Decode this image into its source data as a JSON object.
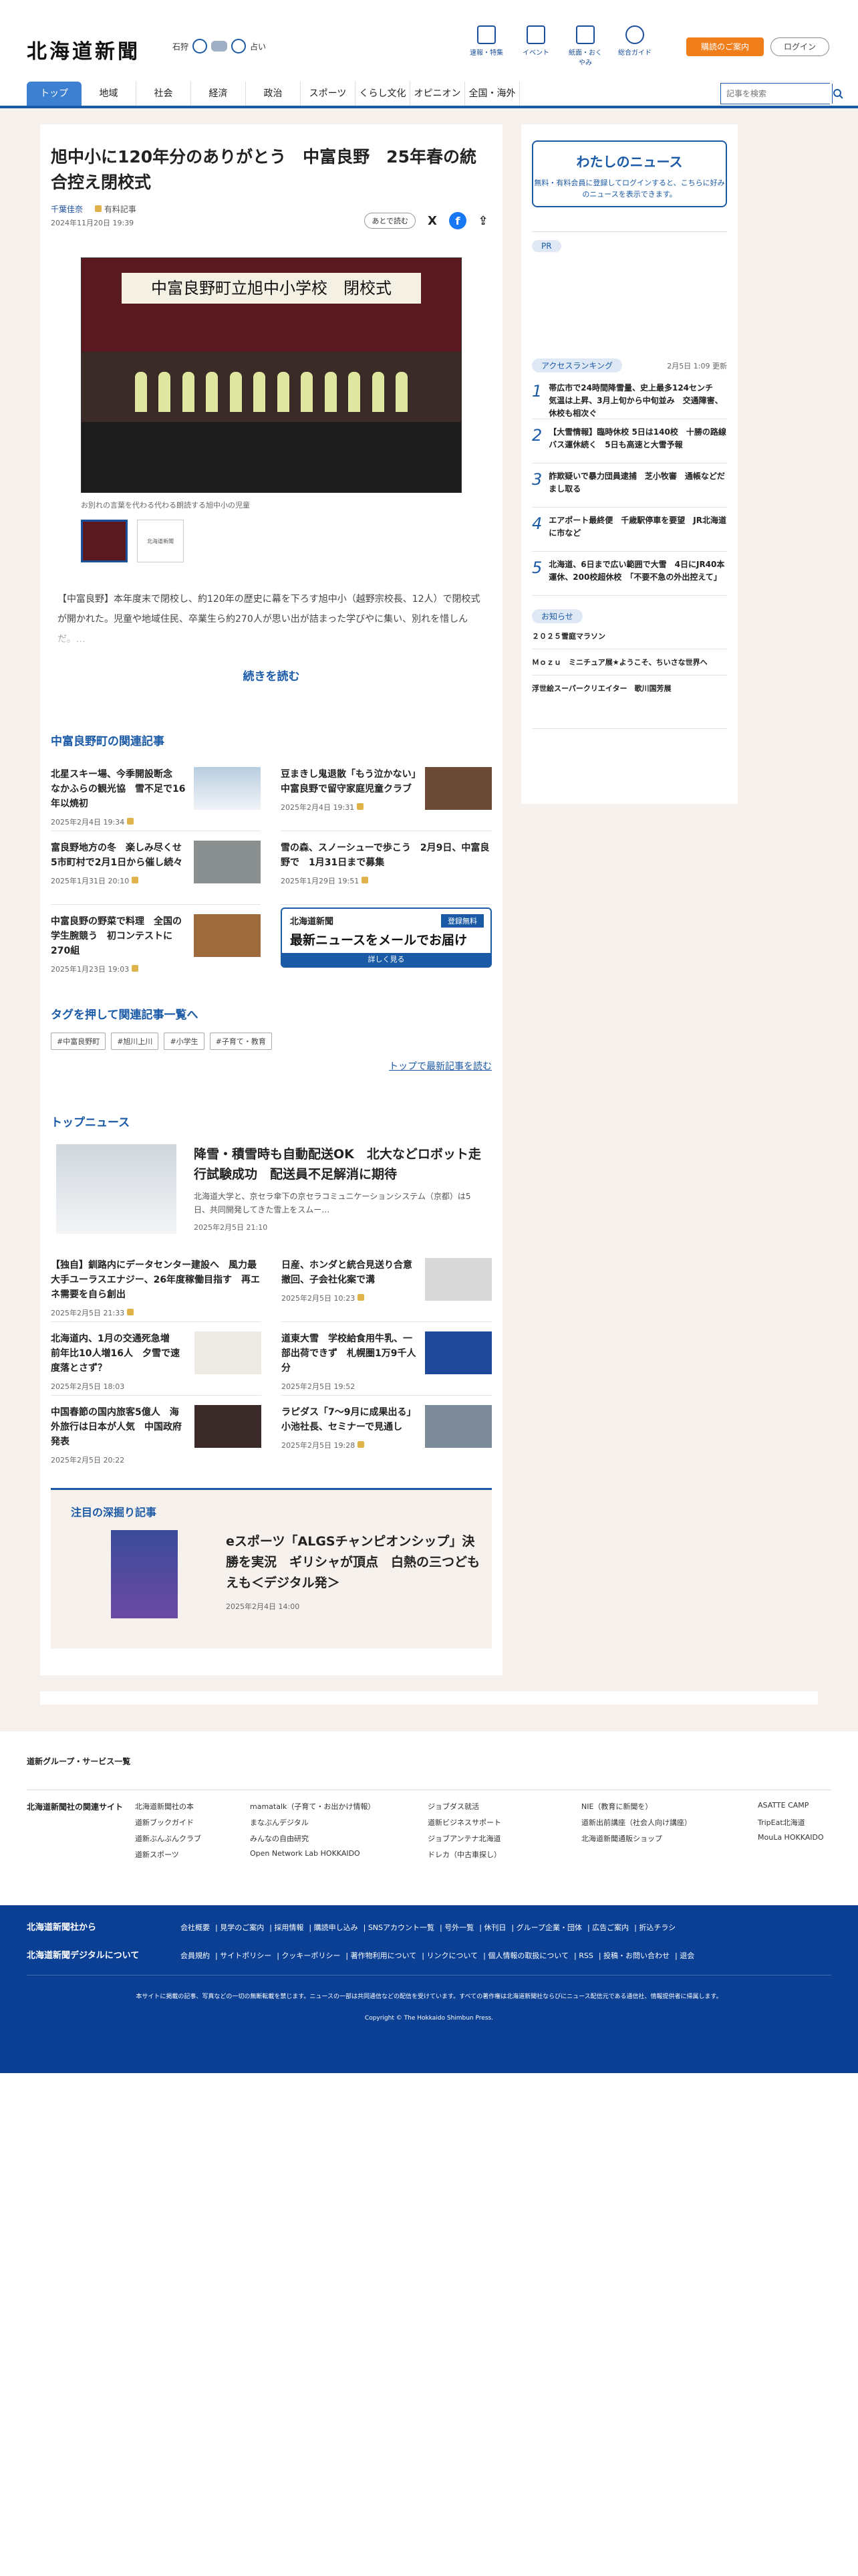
{
  "header": {
    "logo": "北海道新聞",
    "weather": {
      "city": "石狩",
      "wind_label": "占い"
    },
    "nav_icons": [
      {
        "label": "速報・特集",
        "icon": "flag-icon"
      },
      {
        "label": "イベント",
        "icon": "calendar-icon"
      },
      {
        "label": "紙面・おくやみ",
        "icon": "newspaper-icon"
      },
      {
        "label": "総合ガイド",
        "icon": "question-icon"
      }
    ],
    "subscribe": "購読のご案内",
    "login": "ログイン"
  },
  "nav": {
    "items": [
      "トップ",
      "地域",
      "社会",
      "経済",
      "政治",
      "スポーツ",
      "くらし文化",
      "オピニオン",
      "全国・海外"
    ],
    "search_placeholder": "記事を検索"
  },
  "article": {
    "title": "旭中小に120年分のありがとう　中富良野　25年春の統合控え閉校式",
    "author": "千葉佳奈",
    "member_tag": "有料記事",
    "date": "2024年11月20日 19:39",
    "later": "あとで読む",
    "photo_banner": "中富良野町立旭中小学校　閉校式",
    "caption": "お別れの言葉を代わる代わる朗読する旭中小の児童",
    "thumb2": "北海道新聞",
    "lead": "【中富良野】本年度末で閉校し、約120年の歴史に幕を下ろす旭中小（越野宗校長、12人）で閉校式が開かれた。児童や地域住民、卒業生ら約270人が思い出が詰まった学びやに集い、別れを惜しんだ。…",
    "more": "続きを読む"
  },
  "related": {
    "heading": "中富良野町の関連記事",
    "items": [
      {
        "t": "北星スキー場、今季開設断念　なかふらの観光協　雪不足で16年以焼初",
        "d": "2025年2月4日 19:34"
      },
      {
        "t": "豆まきし鬼退散「もう泣かない」　中富良野で留守家庭児童クラブ",
        "d": "2025年2月4日 19:31"
      },
      {
        "t": "富良野地方の冬　楽しみ尽くせ　5市町村で2月1日から催し続々",
        "d": "2025年1月31日 20:10"
      },
      {
        "t": "雪の森、スノーシューで歩こう　2月9日、中富良野で　1月31日まで募集",
        "d": "2025年1月29日 19:51"
      },
      {
        "t": "中富良野の野菜で料理　全国の学生腕競う　初コンテストに270組",
        "d": "2025年1月23日 19:03"
      }
    ],
    "ad": {
      "logo": "北海道新聞",
      "tag": "登録無料",
      "main": "最新ニュースをメールでお届け",
      "btn": "詳しく見る"
    }
  },
  "tagsec": {
    "heading": "タグを押して関連記事一覧へ",
    "tags": [
      "#中富良野町",
      "#旭川上川",
      "#小学生",
      "#子育て・教育"
    ],
    "latest": "トップで最新記事を読む"
  },
  "topnews": {
    "heading": "トップニュース",
    "main": {
      "t": "降雪・積雪時も自動配送OK　北大などロボット走行試験成功　配送員不足解消に期待",
      "s": "北海道大学と、京セラ傘下の京セラコミュニケーションシステム（京都）は5日、共同開発してきた雪上をスムー…",
      "d": "2025年2月5日 21:10"
    },
    "items": [
      {
        "t": "【独自】釧路内にデータセンター建設へ　風力最大手ユーラスエナジー、26年度稼働目指す　再エネ需要を自ら創出",
        "d": "2025年2月5日 21:33"
      },
      {
        "t": "日産、ホンダと統合見送り合意撤回、子会社化案で溝",
        "d": "2025年2月5日 10:23"
      },
      {
        "t": "北海道内、1月の交通死急増　前年比10人増16人　夕雪で速度落とさず？",
        "d": "2025年2月5日 18:03"
      },
      {
        "t": "道東大雪　学校給食用牛乳、一部出荷できず　札幌圏1万9千人分",
        "d": "2025年2月5日 19:52"
      },
      {
        "t": "中国春節の国内旅客5億人　海外旅行は日本が人気　中国政府発表",
        "d": "2025年2月5日 20:22"
      },
      {
        "t": "ラピダス「7～9月に成果出る」　小池社長、セミナーで見通し",
        "d": "2025年2月5日 19:28"
      }
    ]
  },
  "deep": {
    "heading": "注目の深掘り記事",
    "t": "eスポーツ「ALGSチャンピオンシップ」決勝を実況　ギリシャが頂点　白熱の三つどもえも＜デジタル発＞",
    "d": "2025年2月4日 14:00"
  },
  "side": {
    "mynews": {
      "h": "わたしのニュース",
      "s": "無料・有料会員に登録してログインすると、こちらに好みのニュースを表示できます。"
    },
    "pr": "PR",
    "rank_h": "アクセスランキング",
    "rank_d": "2月5日 1:09 更新",
    "rank": [
      "帯広市で24時間降雪量、史上最多124センチ　気温は上昇、3月上旬から中旬並み　交通障害、休校も相次ぐ",
      "【大雪情報】臨時休校 5日は140校　十勝の路線バス運休続く　5日も高速と大雪予報",
      "詐欺疑いで暴力団員逮捕　芝小牧審　通帳などだまし取る",
      "エアポート最終便　千歳駅停車を要望　JR北海道に市など",
      "北海道、6日まで広い範囲で大雪　4日にJR40本運休、200校超休校　「不要不急の外出控えて」"
    ],
    "info_h": "お知らせ",
    "info": [
      "２０２５雪庭マラソン",
      "Ｍｏｚｕ　ミニチュア展★ようこそ、ちいさな世界へ",
      "浮世絵スーパークリエイター　歌川国芳展"
    ]
  },
  "footer": {
    "group_h": "道新グループ・サービス一覧",
    "rel_label": "北海道新聞社の関連サイト",
    "rel": [
      "北海道新聞社の本",
      "mamatalk（子育て・お出かけ情報）",
      "ジョブダス就活",
      "NIE（教育に新聞を）",
      "ASATTE CAMP",
      "道新ブックガイド",
      "まなぶんデジタル",
      "道新ビジネスサポート",
      "道新出前講座（社会人向け講座）",
      "TripEat北海道",
      "道新ぶんぶんクラブ",
      "みんなの自由研究",
      "ジョブアンテナ北海道",
      "北海道新聞通販ショップ",
      "MouLa HOKKAIDO",
      "道新スポーツ",
      "Open Network Lab HOKKAIDO",
      "ドレカ（中古車探し）"
    ],
    "lab1": "北海道新聞社から",
    "lab2": "北海道新聞デジタルについて",
    "links1": [
      "会社概要",
      "見学のご案内",
      "採用情報",
      "購読申し込み",
      "SNSアカウント一覧",
      "号外一覧",
      "休刊日",
      "グループ企業・団体",
      "広告ご案内",
      "折込チラシ"
    ],
    "links2": [
      "会員規約",
      "サイトポリシー",
      "クッキーポリシー",
      "著作物利用について",
      "リンクについて",
      "個人情報の取扱について",
      "RSS",
      "投稿・お問い合わせ",
      "退会"
    ],
    "note": "本サイトに掲載の記事、写真などの一切の無断転載を禁じます。ニュースの一部は共同通信などの配信を受けています。すべての著作権は北海道新聞社ならびにニュース配信元である通信社、情報提供者に帰属します。",
    "copy": "Copyright © The Hokkaido Shimbun Press."
  }
}
